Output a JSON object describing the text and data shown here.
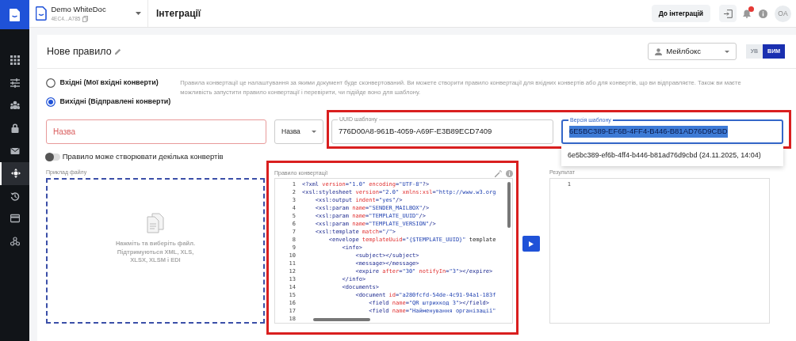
{
  "workspace": {
    "name": "Demo WhiteDoc",
    "id": "4EC4...A785"
  },
  "page_title": "Інтеграції",
  "header": {
    "back_button": "До інтеграцій",
    "avatar": "OA"
  },
  "sidebar": {
    "items": [
      {
        "selected": false
      },
      {
        "selected": false
      },
      {
        "selected": false
      },
      {
        "selected": false
      },
      {
        "selected": false
      },
      {
        "selected": true
      },
      {
        "selected": false
      },
      {
        "selected": false
      },
      {
        "selected": false
      }
    ]
  },
  "rule": {
    "title": "Нове правило",
    "mailbox_select": "Мейлбокс",
    "direction_toggle": [
      {
        "label": "УВ",
        "selected": false
      },
      {
        "label": "ВИМ",
        "selected": true
      }
    ],
    "direction_options": [
      {
        "label": "Вхідні (Мої вхідні конверти)",
        "selected": false
      },
      {
        "label": "Вихідні (Відправлені конверти)",
        "selected": true
      }
    ],
    "description": "Правила конвертації це налаштування за якими документ буде сконвертований. Ви можете створити правило конвертації для вхідних конвертів або для конвертів, що ви відправляєте. Також ви маєте можливість запустити правило конвертації і перевірити, чи підійде воно для шаблону.",
    "name_field": {
      "placeholder": "Назва",
      "invalid": true
    },
    "field_select": "Назва",
    "template_fields": {
      "highlighted": true,
      "uuid": {
        "label": "UUID шаблону",
        "value": "776D00A8-961B-4059-A69F-E3B89ECD7409"
      },
      "version": {
        "label": "Версія шаблону",
        "value": "6E5BC389-EF6B-4FF4-B446-B81AD76D9CBD",
        "focused": true,
        "text_selected": true
      },
      "version_options": [
        "6e5bc389-ef6b-4ff4-b446-b81ad76d9cbd (24.11.2025, 14:04)"
      ]
    },
    "multiple_toggle": {
      "label": "Правило може створювати декілька конвертів",
      "on": false
    },
    "file_example": {
      "label": "Приклад файлу",
      "hint": "Нажміть та виберіть файл. Підтримуються XML, XLS, XLSX, XLSM і EDI"
    },
    "converter": {
      "label": "Правило конвертації",
      "highlighted": true,
      "lines": [
        {
          "number": "1",
          "code": "<?xml version=\"1.0\" encoding=\"UTF-8\"?>"
        },
        {
          "number": "2",
          "code": "<xsl:stylesheet version=\"2.0\" xmlns:xsl=\"http://www.w3.org"
        },
        {
          "number": "3",
          "code": "    <xsl:output indent=\"yes\"/>"
        },
        {
          "number": "4",
          "code": "    <xsl:param name=\"SENDER_MAILBOX\"/>"
        },
        {
          "number": "5",
          "code": "    <xsl:param name=\"TEMPLATE_UUID\"/>"
        },
        {
          "number": "6",
          "code": "    <xsl:param name=\"TEMPLATE_VERSION\"/>"
        },
        {
          "number": "7",
          "code": "    <xsl:template match=\"/\">"
        },
        {
          "number": "8",
          "code": "        <envelope templateUuid=\"{$TEMPLATE_UUID}\" template"
        },
        {
          "number": "9",
          "code": "            <info>"
        },
        {
          "number": "10",
          "code": "                <subject></subject>"
        },
        {
          "number": "11",
          "code": "                <message></message>"
        },
        {
          "number": "12",
          "code": "                <expire after=\"30\" notifyIn=\"3\"></expire>"
        },
        {
          "number": "13",
          "code": "            </info>"
        },
        {
          "number": "14",
          "code": "            <documents>"
        },
        {
          "number": "15",
          "code": "                <document id=\"a280fcfd-54de-4c91-94a1-183f"
        },
        {
          "number": "16",
          "code": "                    <field name=\"QR штрихкод 3\"></field>"
        },
        {
          "number": "17",
          "code": "                    <field name=\"Найменування організації\""
        },
        {
          "number": "18"
        }
      ]
    },
    "result": {
      "label": "Результат",
      "lines": [
        {
          "number": "1"
        }
      ]
    }
  }
}
